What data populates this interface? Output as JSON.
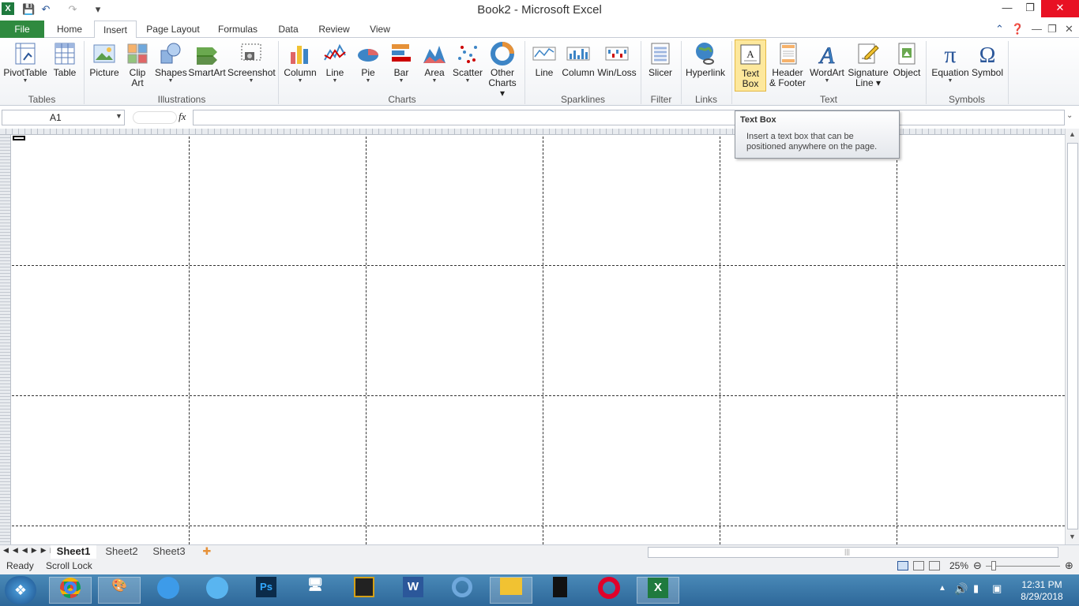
{
  "window": {
    "title": "Book2  -  Microsoft Excel",
    "app_icon": "X"
  },
  "tabs": {
    "file": "File",
    "items": [
      "Home",
      "Insert",
      "Page Layout",
      "Formulas",
      "Data",
      "Review",
      "View"
    ],
    "active": "Insert"
  },
  "ribbon": {
    "tables": {
      "group": "Tables",
      "pivottable": "PivotTable",
      "table": "Table"
    },
    "illustrations": {
      "group": "Illustrations",
      "picture": "Picture",
      "clipart_1": "Clip",
      "clipart_2": "Art",
      "shapes": "Shapes",
      "smartart": "SmartArt",
      "screenshot": "Screenshot"
    },
    "charts": {
      "group": "Charts",
      "column": "Column",
      "line": "Line",
      "pie": "Pie",
      "bar": "Bar",
      "area": "Area",
      "scatter": "Scatter",
      "other_1": "Other",
      "other_2": "Charts"
    },
    "sparklines": {
      "group": "Sparklines",
      "line": "Line",
      "column": "Column",
      "winloss": "Win/Loss"
    },
    "filter": {
      "group": "Filter",
      "slicer": "Slicer"
    },
    "links": {
      "group": "Links",
      "hyperlink": "Hyperlink"
    },
    "text": {
      "group": "Text",
      "textbox_1": "Text",
      "textbox_2": "Box",
      "header_1": "Header",
      "header_2": "& Footer",
      "wordart": "WordArt",
      "signature_1": "Signature",
      "signature_2": "Line",
      "object": "Object"
    },
    "symbols": {
      "group": "Symbols",
      "equation": "Equation",
      "symbol": "Symbol"
    }
  },
  "formula_bar": {
    "namebox": "A1",
    "fx": "fx",
    "value": ""
  },
  "tooltip": {
    "title": "Text Box",
    "line1": "Insert a text box that can be",
    "line2": "positioned anywhere on the page."
  },
  "sheets": [
    "Sheet1",
    "Sheet2",
    "Sheet3"
  ],
  "active_sheet": "Sheet1",
  "status": {
    "ready": "Ready",
    "scroll_lock": "Scroll Lock",
    "zoom": "25%"
  },
  "taskbar": {
    "time": "12:31 PM",
    "date": "8/29/2018"
  },
  "colors": {
    "file_tab": "#2f8a3f",
    "excel_green": "#1f7a3e",
    "close": "#e81123",
    "taskbar": "#2d6799",
    "highlight": "#fde89c"
  }
}
